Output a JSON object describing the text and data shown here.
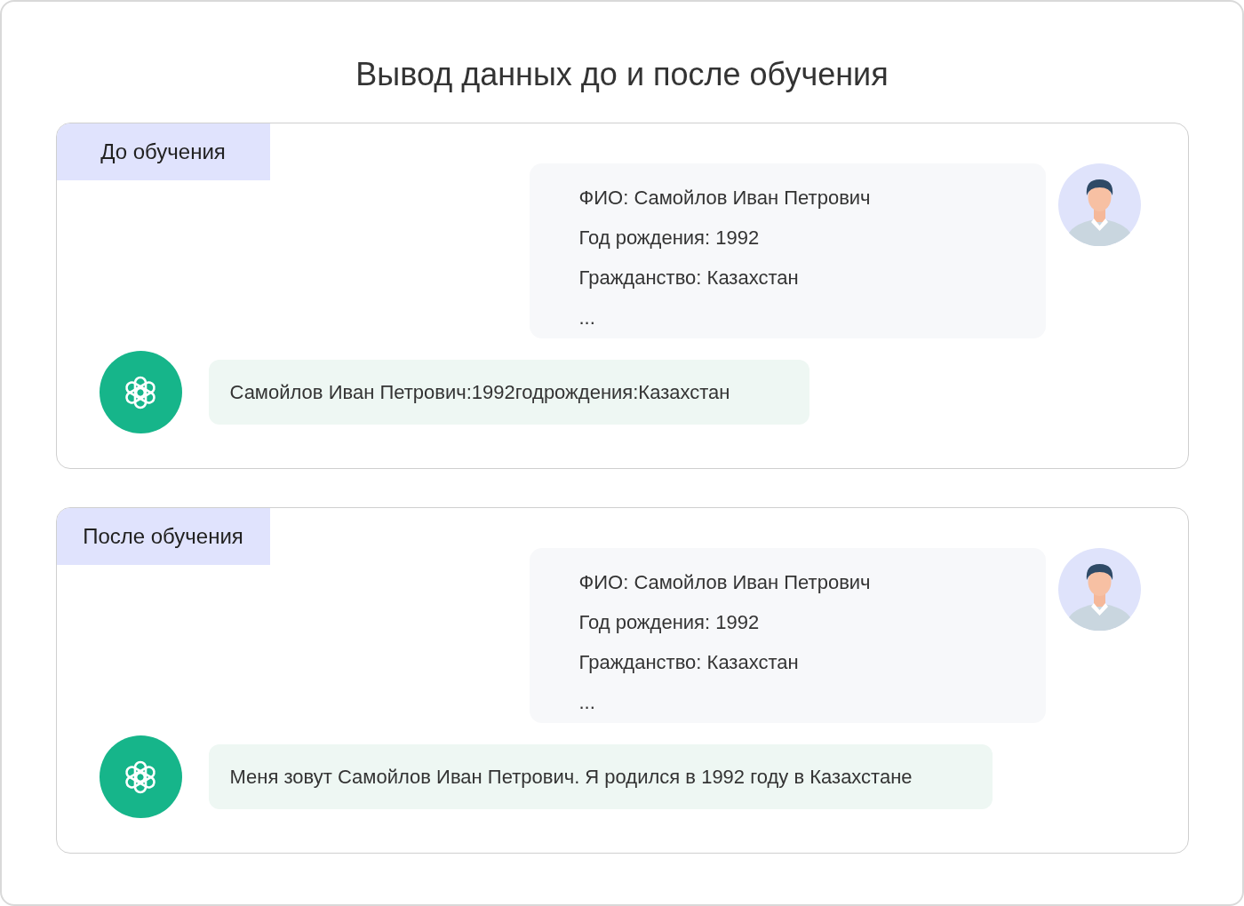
{
  "title": "Вывод данных до и после обучения",
  "sections": [
    {
      "label": "До обучения",
      "user_message": {
        "lines": [
          "ФИО: Самойлов Иван Петрович",
          "Год рождения: 1992",
          "Гражданство: Казахстан",
          "..."
        ]
      },
      "bot_reply": "Самойлов Иван Петрович:1992годрождения:Казахстан"
    },
    {
      "label": "После обучения",
      "user_message": {
        "lines": [
          "ФИО: Самойлов Иван Петрович",
          "Год рождения: 1992",
          "Гражданство: Казахстан",
          "..."
        ]
      },
      "bot_reply": "Меня зовут Самойлов Иван Петрович. Я родился в 1992 году в Казахстане"
    }
  ]
}
